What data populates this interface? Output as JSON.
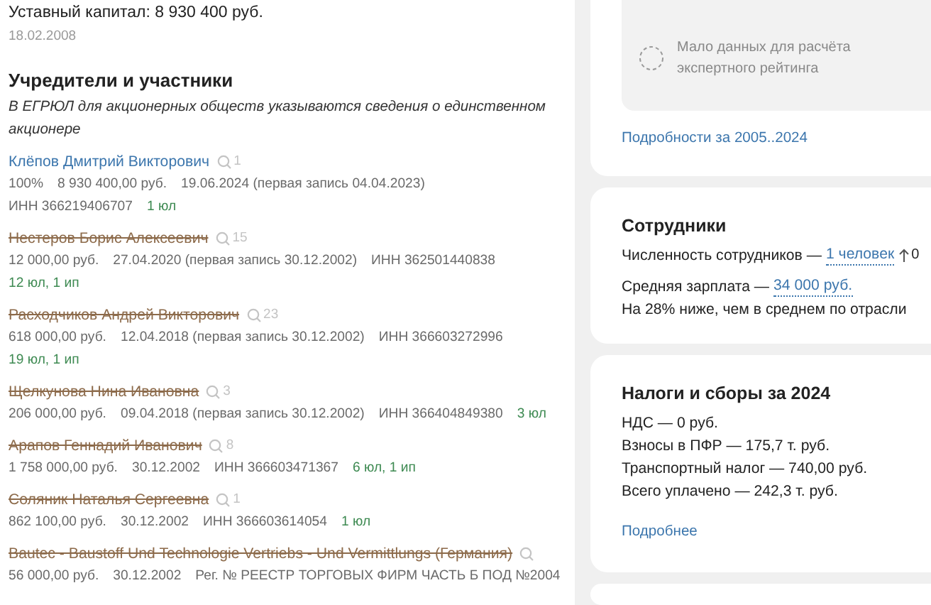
{
  "capital": {
    "label": "Уставный капитал: 8 930 400 руб.",
    "date": "18.02.2008"
  },
  "founders_section": {
    "title": "Учредители и участники",
    "note": "В ЕГРЮЛ для акционерных обществ указываются сведения о единственном акционере",
    "founders": [
      {
        "name": "Клёпов Дмитрий Викторович",
        "former": false,
        "count": "1",
        "lines": [
          [
            {
              "kind": "plain",
              "text": "100%"
            },
            {
              "kind": "plain",
              "text": "8 930 400,00 руб."
            },
            {
              "kind": "plain",
              "text": "19.06.2024 (первая запись 04.04.2023)"
            }
          ],
          [
            {
              "kind": "plain",
              "text": "ИНН 366219406707"
            },
            {
              "kind": "links",
              "text": "1 юл"
            }
          ]
        ]
      },
      {
        "name": "Нестеров Борис Алексеевич",
        "former": true,
        "count": "15",
        "lines": [
          [
            {
              "kind": "plain",
              "text": "12 000,00 руб."
            },
            {
              "kind": "plain",
              "text": "27.04.2020 (первая запись 30.12.2002)"
            },
            {
              "kind": "plain",
              "text": "ИНН 362501440838"
            }
          ],
          [
            {
              "kind": "links",
              "text": "12 юл, 1 ип"
            }
          ]
        ]
      },
      {
        "name": "Расходчиков Андрей Викторович",
        "former": true,
        "count": "23",
        "lines": [
          [
            {
              "kind": "plain",
              "text": "618 000,00 руб."
            },
            {
              "kind": "plain",
              "text": "12.04.2018 (первая запись 30.12.2002)"
            },
            {
              "kind": "plain",
              "text": "ИНН 366603272996"
            }
          ],
          [
            {
              "kind": "links",
              "text": "19 юл, 1 ип"
            }
          ]
        ]
      },
      {
        "name": "Щелкунова Нина Ивановна",
        "former": true,
        "count": "3",
        "lines": [
          [
            {
              "kind": "plain",
              "text": "206 000,00 руб."
            },
            {
              "kind": "plain",
              "text": "09.04.2018 (первая запись 30.12.2002)"
            },
            {
              "kind": "plain",
              "text": "ИНН 366404849380"
            },
            {
              "kind": "links",
              "text": "3 юл"
            }
          ]
        ]
      },
      {
        "name": "Арапов Геннадий Иванович",
        "former": true,
        "count": "8",
        "lines": [
          [
            {
              "kind": "plain",
              "text": "1 758 000,00 руб."
            },
            {
              "kind": "plain",
              "text": "30.12.2002"
            },
            {
              "kind": "plain",
              "text": "ИНН 366603471367"
            },
            {
              "kind": "links",
              "text": "6 юл, 1 ип"
            }
          ]
        ]
      },
      {
        "name": "Соляник Наталья Сергеевна",
        "former": true,
        "count": "1",
        "lines": [
          [
            {
              "kind": "plain",
              "text": "862 100,00 руб."
            },
            {
              "kind": "plain",
              "text": "30.12.2002"
            },
            {
              "kind": "plain",
              "text": "ИНН 366603614054"
            },
            {
              "kind": "links",
              "text": "1 юл"
            }
          ]
        ]
      },
      {
        "name": "Bautec - Baustoff Und Technologie Vertriebs - Und Vermittlungs (Германия)",
        "former": true,
        "lines": [
          [
            {
              "kind": "plain",
              "text": "56 000,00 руб."
            },
            {
              "kind": "plain",
              "text": "30.12.2002"
            },
            {
              "kind": "plain",
              "text": "Рег. № РЕЕСТР ТОРГОВЫХ ФИРМ ЧАСТЬ Б ПОД №2004"
            }
          ]
        ]
      }
    ]
  },
  "rating_card": {
    "message": "Мало данных для расчёта экспертного рейтинга",
    "link": "Подробности за 2005..2024"
  },
  "employees_card": {
    "title": "Сотрудники",
    "headcount_label": "Численность сотрудников —",
    "headcount_value": "1 человек",
    "headcount_change": "0",
    "salary_label": "Средняя зарплата —",
    "salary_value": "34 000 руб.",
    "salary_note": "На 28% ниже, чем в среднем по отрасли"
  },
  "taxes_card": {
    "title": "Налоги и сборы за 2024",
    "lines": [
      "НДС — 0 руб.",
      "Взносы в ПФР — 175,7 т. руб.",
      "Транспортный налог — 740,00 руб.",
      "Всего уплачено — 242,3 т. руб."
    ],
    "link": "Подробнее"
  }
}
